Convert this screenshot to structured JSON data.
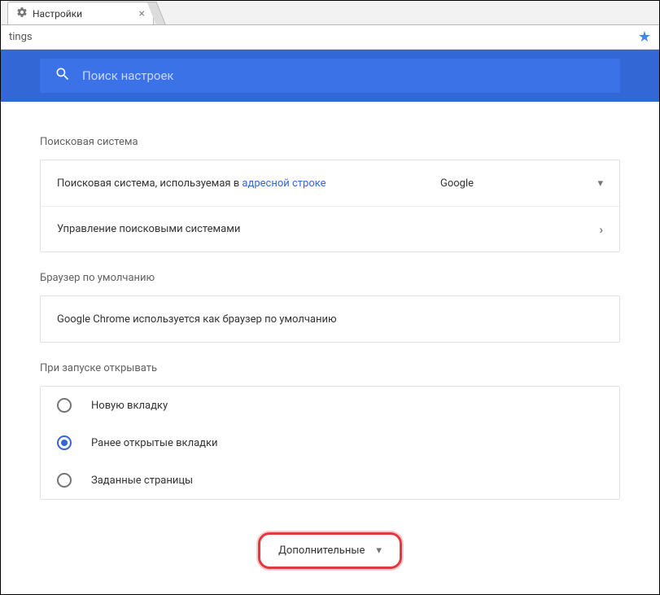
{
  "tab": {
    "title": "Настройки"
  },
  "address": {
    "visible": "tings"
  },
  "search": {
    "placeholder": "Поиск настроек"
  },
  "sections": {
    "engine": {
      "title": "Поисковая система",
      "row1_prefix": "Поисковая система, используемая в ",
      "row1_link": "адресной строке",
      "row1_value": "Google",
      "row2_label": "Управление поисковыми системами"
    },
    "defaultBrowser": {
      "title": "Браузер по умолчанию",
      "text": "Google Chrome используется как браузер по умолчанию"
    },
    "startup": {
      "title": "При запуске открывать",
      "options": {
        "0": "Новую вкладку",
        "1": "Ранее открытые вкладки",
        "2": "Заданные страницы"
      }
    }
  },
  "advanced": {
    "label": "Дополнительные"
  }
}
